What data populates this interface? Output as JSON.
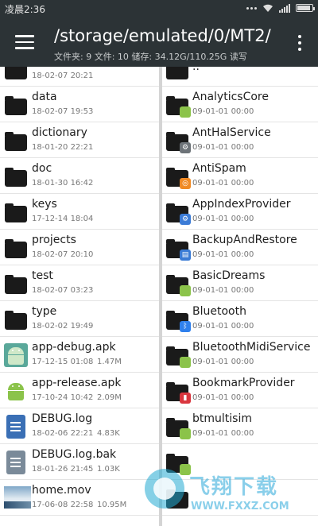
{
  "status_bar": {
    "time": "凌晨2:36",
    "icons": [
      "notification-dots-icon",
      "wifi-icon",
      "signal-icon",
      "battery-icon"
    ]
  },
  "toolbar": {
    "menu_icon": "hamburger-menu-icon",
    "path": "/storage/emulated/0/MT2/",
    "info": "文件夹: 9  文件: 10  储存: 34.12G/110.25G  读写",
    "overflow_icon": "more-vertical-icon"
  },
  "left_pane": {
    "items": [
      {
        "name": "",
        "date": "18-02-07 20:21",
        "size": "",
        "type": "folder"
      },
      {
        "name": "data",
        "date": "18-02-07 19:53",
        "size": "",
        "type": "folder"
      },
      {
        "name": "dictionary",
        "date": "18-01-20 22:21",
        "size": "",
        "type": "folder"
      },
      {
        "name": "doc",
        "date": "18-01-30 16:42",
        "size": "",
        "type": "folder"
      },
      {
        "name": "keys",
        "date": "17-12-14 18:04",
        "size": "",
        "type": "folder"
      },
      {
        "name": "projects",
        "date": "18-02-07 20:10",
        "size": "",
        "type": "folder"
      },
      {
        "name": "test",
        "date": "18-02-07 03:23",
        "size": "",
        "type": "folder"
      },
      {
        "name": "type",
        "date": "18-02-02 19:49",
        "size": "",
        "type": "folder"
      },
      {
        "name": "app-debug.apk",
        "date": "17-12-15 01:08",
        "size": "1.47M",
        "type": "apk-debug"
      },
      {
        "name": "app-release.apk",
        "date": "17-10-24 10:42",
        "size": "2.09M",
        "type": "apk"
      },
      {
        "name": "DEBUG.log",
        "date": "18-02-06 22:21",
        "size": "4.83K",
        "type": "log"
      },
      {
        "name": "DEBUG.log.bak",
        "date": "18-01-26 21:45",
        "size": "1.03K",
        "type": "bak"
      },
      {
        "name": "home.mov",
        "date": "17-06-08 22:58",
        "size": "10.95M",
        "type": "video"
      }
    ]
  },
  "right_pane": {
    "items": [
      {
        "name": "..",
        "date": "",
        "badge": ""
      },
      {
        "name": "AnalyticsCore",
        "date": "09-01-01 00:00",
        "badge": "apk"
      },
      {
        "name": "AntHalService",
        "date": "09-01-01 00:00",
        "badge": "gear-grey"
      },
      {
        "name": "AntiSpam",
        "date": "09-01-01 00:00",
        "badge": "orange"
      },
      {
        "name": "AppIndexProvider",
        "date": "09-01-01 00:00",
        "badge": "gear-blue"
      },
      {
        "name": "BackupAndRestore",
        "date": "09-01-01 00:00",
        "badge": "backup"
      },
      {
        "name": "BasicDreams",
        "date": "09-01-01 00:00",
        "badge": "apk"
      },
      {
        "name": "Bluetooth",
        "date": "09-01-01 00:00",
        "badge": "bluetooth"
      },
      {
        "name": "BluetoothMidiService",
        "date": "09-01-01 00:00",
        "badge": "apk"
      },
      {
        "name": "BookmarkProvider",
        "date": "09-01-01 00:00",
        "badge": "bookmark"
      },
      {
        "name": "btmultisim",
        "date": "09-01-01 00:00",
        "badge": "apk"
      },
      {
        "name": "",
        "date": "",
        "badge": "apk"
      },
      {
        "name": "",
        "date": "",
        "badge": ""
      }
    ]
  },
  "watermark": {
    "title": "飞翔下载",
    "url": "WWW.FXXZ.COM"
  },
  "colors": {
    "toolbar_bg": "#2c3336",
    "android_green": "#8bc34a",
    "doc_blue": "#3a6fb5",
    "bak_grey": "#7a8a99"
  }
}
